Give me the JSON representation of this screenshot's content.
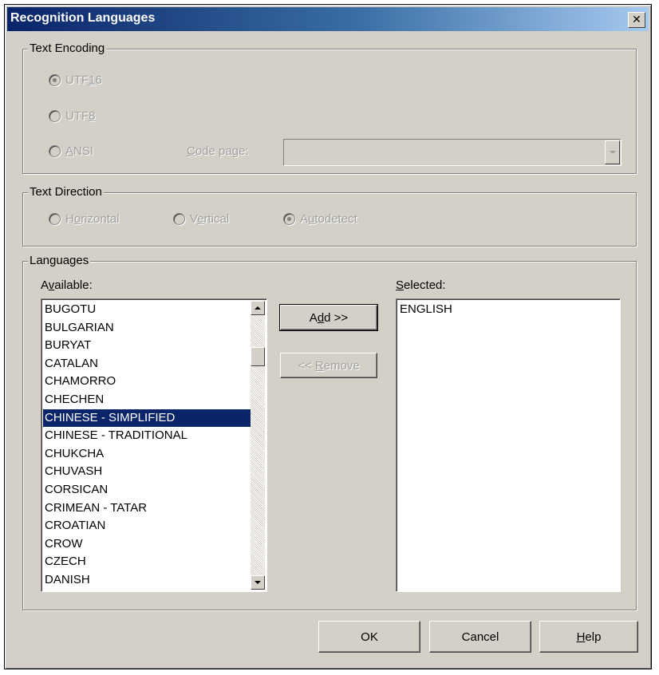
{
  "window": {
    "title": "Recognition Languages"
  },
  "text_encoding": {
    "legend": "Text Encoding",
    "options": [
      {
        "label": "UTF16",
        "selected": true
      },
      {
        "label": "UTF8",
        "selected": false
      },
      {
        "label": "ANSI",
        "selected": false
      }
    ],
    "code_page_label": "Code page:",
    "code_page_value": ""
  },
  "text_direction": {
    "legend": "Text Direction",
    "options": [
      {
        "label": "Horizontal",
        "selected": false
      },
      {
        "label": "Vertical",
        "selected": false
      },
      {
        "label": "Autodetect",
        "selected": true
      }
    ]
  },
  "languages": {
    "legend": "Languages",
    "available_label": "Available:",
    "selected_label": "Selected:",
    "available": [
      "BUGOTU",
      "BULGARIAN",
      "BURYAT",
      "CATALAN",
      "CHAMORRO",
      "CHECHEN",
      "CHINESE - SIMPLIFIED",
      "CHINESE - TRADITIONAL",
      "CHUKCHA",
      "CHUVASH",
      "CORSICAN",
      "CRIMEAN - TATAR",
      "CROATIAN",
      "CROW",
      "CZECH",
      "DANISH"
    ],
    "available_selected": "CHINESE - SIMPLIFIED",
    "selected": [
      "ENGLISH"
    ],
    "add_label": "Add >>",
    "remove_label": "<< Remove"
  },
  "buttons": {
    "ok": "OK",
    "cancel": "Cancel",
    "help": "Help"
  }
}
